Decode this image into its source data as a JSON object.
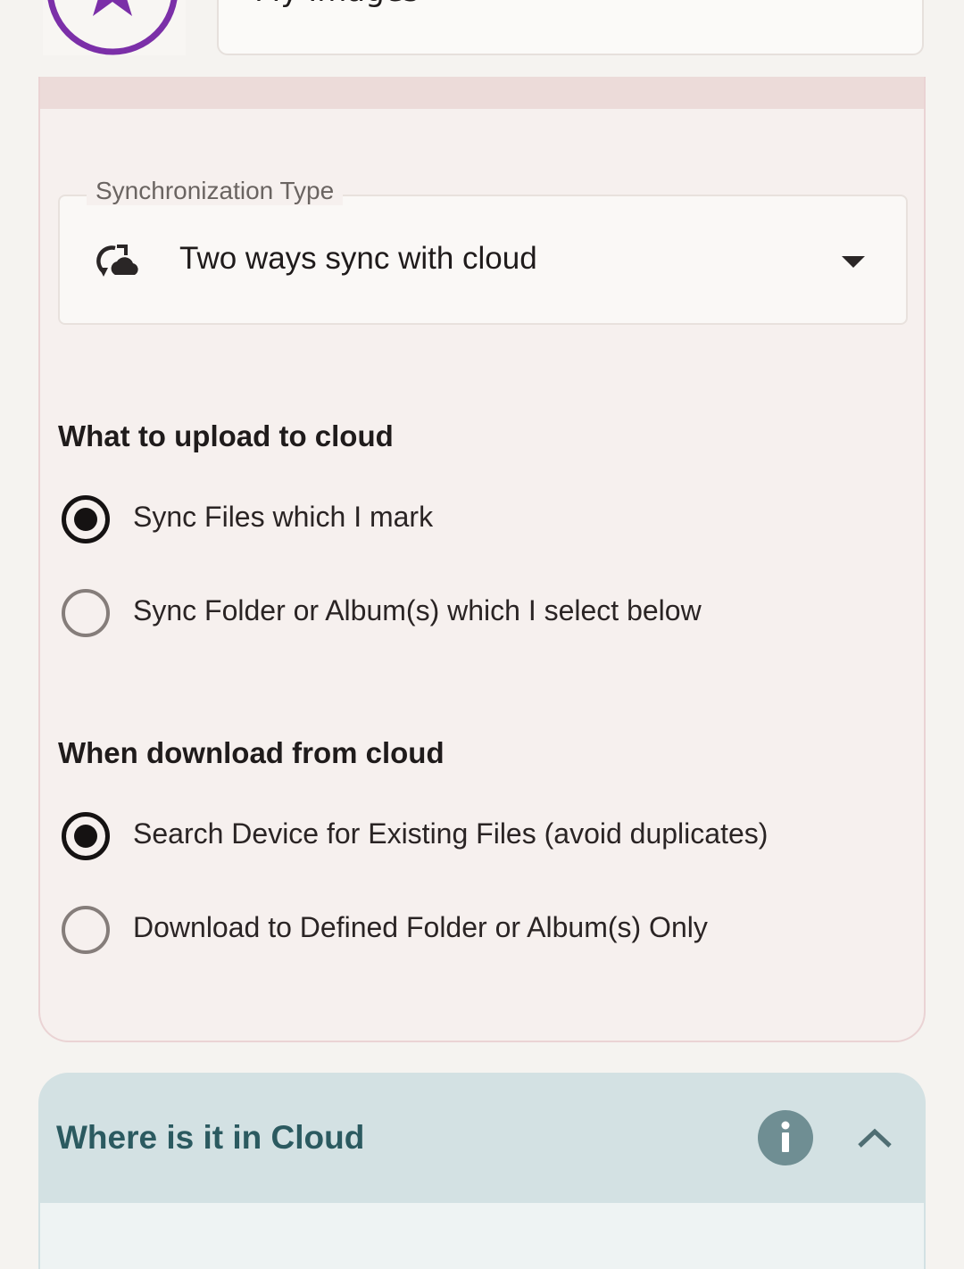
{
  "header": {
    "album_icon": "star-circle-icon",
    "album_name": "My Images"
  },
  "sync_type": {
    "label": "Synchronization Type",
    "value": "Two ways sync with cloud",
    "icon": "cloud-sync-icon",
    "dropdown_icon": "arrow-drop-down-icon"
  },
  "upload_section": {
    "title": "What to upload to cloud",
    "options": [
      {
        "label": "Sync Files which I mark",
        "checked": true
      },
      {
        "label": "Sync Folder or Album(s) which I select below",
        "checked": false
      }
    ]
  },
  "download_section": {
    "title": "When download from cloud",
    "options": [
      {
        "label": "Search Device for Existing Files (avoid duplicates)",
        "checked": true
      },
      {
        "label": "Download to Defined Folder or Album(s) Only",
        "checked": false
      }
    ]
  },
  "cloud_location": {
    "title": "Where is it in Cloud",
    "info_icon": "info-icon",
    "collapse_icon": "chevron-up-icon"
  },
  "colors": {
    "accent_purple": "#7b2fa8",
    "section_teal": "#2b5a60",
    "card_bg": "#f6f0ee",
    "cloud_card_bg": "#d3e1e3"
  }
}
